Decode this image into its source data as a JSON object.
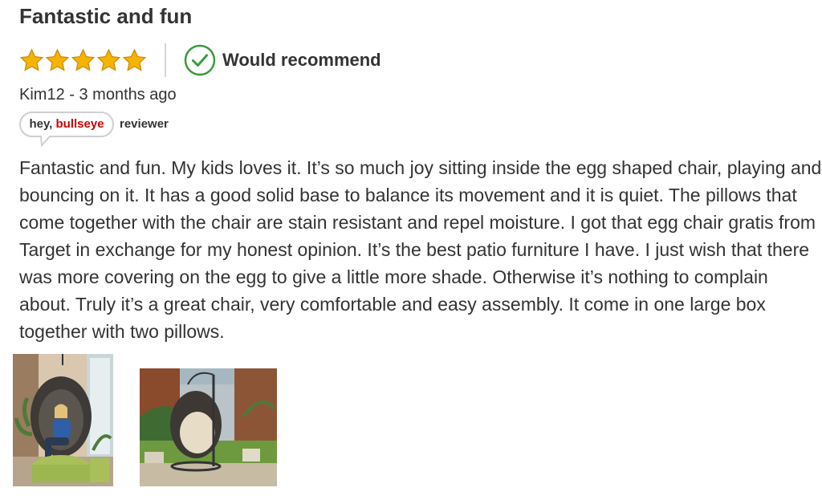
{
  "review": {
    "title": "Fantastic and fun",
    "rating": 5,
    "rating_max": 5,
    "recommend_label": "Would recommend",
    "author": "Kim12",
    "byline_separator": " - ",
    "posted": "3 months ago",
    "badge": {
      "prefix": "hey, ",
      "brand": "bullseye",
      "label": "reviewer"
    },
    "body": "Fantastic and fun. My kids loves it. It’s so much joy sitting inside the egg shaped chair, playing and bouncing on it. It has a good solid base to balance its movement and it is quiet. The pillows that come together with the chair are stain resistant and repel moisture. I got that egg chair gratis from Target in exchange for my honest opinion. It’s the best patio furniture I have. I just wish that there was more covering on the egg to give a little more shade. Otherwise it’s nothing to complain about. Truly it’s a great chair, very comfortable and easy assembly. It come in one large box together with two pillows."
  },
  "photos": [
    {
      "subject": "woman-in-egg-chair-indoors"
    },
    {
      "subject": "egg-chair-on-patio-lawn"
    }
  ],
  "colors": {
    "star": "#f5b400",
    "star_outline": "#d18a00",
    "check": "#3a9a3a",
    "brand": "#cc0000",
    "text": "#333333",
    "divider": "#d6d6d6"
  },
  "icons": {
    "star": "star-icon",
    "recommend": "check-circle-icon"
  }
}
